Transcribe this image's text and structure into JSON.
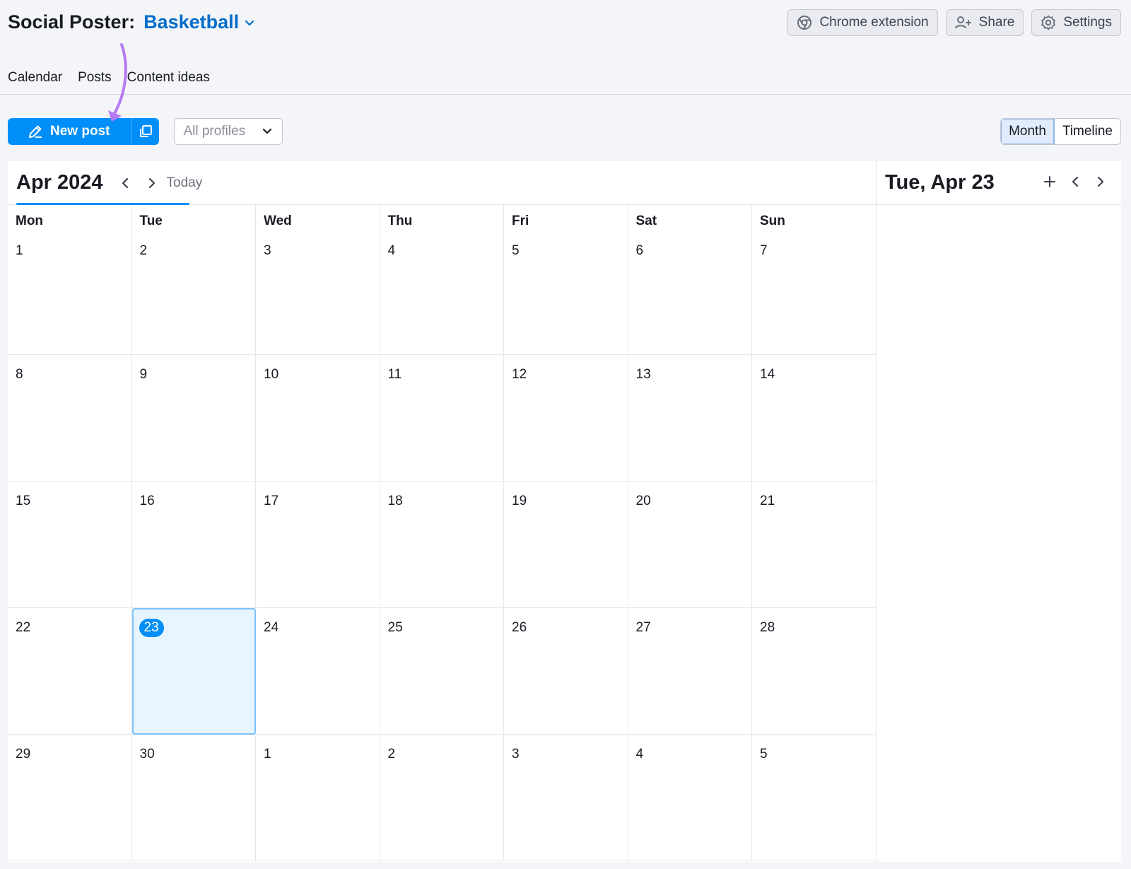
{
  "header": {
    "app_title": "Social Poster:",
    "project_name": "Basketball"
  },
  "top_actions": {
    "chrome_extension": "Chrome extension",
    "share": "Share",
    "settings": "Settings"
  },
  "tabs": [
    {
      "label": "Calendar"
    },
    {
      "label": "Posts"
    },
    {
      "label": "Content ideas"
    }
  ],
  "toolbar": {
    "new_post": "New post",
    "profiles_select": "All profiles"
  },
  "view_toggle": {
    "month": "Month",
    "timeline": "Timeline",
    "active": "Month"
  },
  "calendar": {
    "month_label": "Apr 2024",
    "today_label": "Today",
    "weekdays": [
      "Mon",
      "Tue",
      "Wed",
      "Thu",
      "Fri",
      "Sat",
      "Sun"
    ],
    "weeks": [
      [
        "1",
        "2",
        "3",
        "4",
        "5",
        "6",
        "7"
      ],
      [
        "8",
        "9",
        "10",
        "11",
        "12",
        "13",
        "14"
      ],
      [
        "15",
        "16",
        "17",
        "18",
        "19",
        "20",
        "21"
      ],
      [
        "22",
        "23",
        "24",
        "25",
        "26",
        "27",
        "28"
      ],
      [
        "29",
        "30",
        "1",
        "2",
        "3",
        "4",
        "5"
      ]
    ],
    "selected_day": "23"
  },
  "side_panel": {
    "date_title": "Tue, Apr 23"
  },
  "colors": {
    "brand_blue": "#008ff8",
    "project_blue": "#006dca",
    "annotation_purple": "#b57cf2"
  }
}
